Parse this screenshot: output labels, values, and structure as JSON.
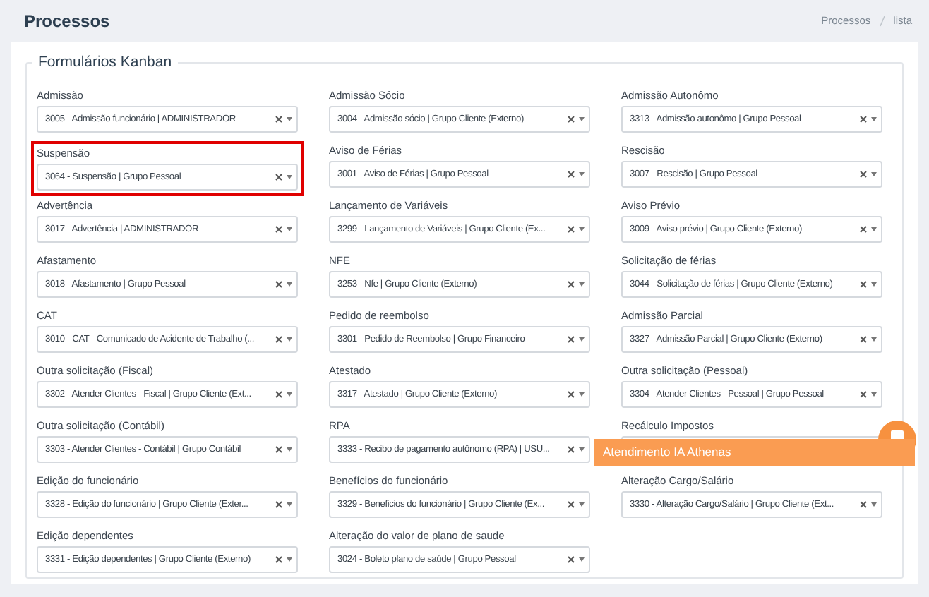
{
  "page_title": "Processos",
  "breadcrumb": [
    {
      "label": "Processos"
    },
    {
      "label": "lista"
    }
  ],
  "section": {
    "title": "Formulários Kanban",
    "fields": [
      {
        "label": "Admissão",
        "value": "3005 - Admissão funcionário | ADMINISTRADOR",
        "highlighted": false
      },
      {
        "label": "Admissão Sócio",
        "value": "3004 - Admissão sócio | Grupo Cliente (Externo)",
        "highlighted": false
      },
      {
        "label": "Admissão Autonômo",
        "value": "3313 - Admissão autonômo | Grupo Pessoal",
        "highlighted": false
      },
      {
        "label": "Suspensão",
        "value": "3064 - Suspensão | Grupo Pessoal",
        "highlighted": true
      },
      {
        "label": "Aviso de Férias",
        "value": "3001 - Aviso de Férias | Grupo Pessoal",
        "highlighted": false
      },
      {
        "label": "Rescisão",
        "value": "3007 - Rescisão | Grupo Pessoal",
        "highlighted": false
      },
      {
        "label": "Advertência",
        "value": "3017 - Advertência | ADMINISTRADOR",
        "highlighted": false
      },
      {
        "label": "Lançamento de Variáveis",
        "value": "3299 - Lançamento de Variáveis | Grupo Cliente (Ex...",
        "highlighted": false
      },
      {
        "label": "Aviso Prévio",
        "value": "3009 - Aviso prévio | Grupo Cliente (Externo)",
        "highlighted": false
      },
      {
        "label": "Afastamento",
        "value": "3018 - Afastamento | Grupo Pessoal",
        "highlighted": false
      },
      {
        "label": "NFE",
        "value": "3253 - Nfe | Grupo Cliente (Externo)",
        "highlighted": false
      },
      {
        "label": "Solicitação de férias",
        "value": "3044 - Solicitação de férias | Grupo Cliente (Externo)",
        "highlighted": false
      },
      {
        "label": "CAT",
        "value": "3010 - CAT - Comunicado de Acidente de Trabalho (...",
        "highlighted": false
      },
      {
        "label": "Pedido de reembolso",
        "value": "3301 - Pedido de Reembolso | Grupo Financeiro",
        "highlighted": false
      },
      {
        "label": "Admissão Parcial",
        "value": "3327 - Admissão Parcial | Grupo Cliente (Externo)",
        "highlighted": false
      },
      {
        "label": "Outra solicitação (Fiscal)",
        "value": "3302 - Atender Clientes - Fiscal | Grupo Cliente (Ext...",
        "highlighted": false
      },
      {
        "label": "Atestado",
        "value": "3317 - Atestado | Grupo Cliente (Externo)",
        "highlighted": false
      },
      {
        "label": "Outra solicitação (Pessoal)",
        "value": "3304 - Atender Clientes - Pessoal | Grupo Pessoal",
        "highlighted": false
      },
      {
        "label": "Outra solicitação (Contábil)",
        "value": "3303 - Atender Clientes - Contábil | Grupo Contábil",
        "highlighted": false
      },
      {
        "label": "RPA",
        "value": "3333 - Recibo de pagamento autônomo (RPA) | USU...",
        "highlighted": false
      },
      {
        "label": "Recálculo Impostos",
        "highlighted": false
      },
      {
        "label": "Edição do funcionário",
        "value": "3328 - Edição do funcionário | Grupo Cliente (Exter...",
        "highlighted": false
      },
      {
        "label": "Benefícios do funcionário",
        "value": "3329 - Beneficios do funcionário | Grupo Cliente (Ex...",
        "highlighted": false
      },
      {
        "label": "Alteração Cargo/Salário",
        "value": "3330 - Alteração Cargo/Salário | Grupo Cliente (Ext...",
        "highlighted": false
      },
      {
        "label": "Edição dependentes",
        "value": "3331 - Edição dependentes | Grupo Cliente (Externo)",
        "highlighted": false
      },
      {
        "label": "Alteração do valor de plano de saude",
        "value": "3024 - Boleto plano de saúde | Grupo Pessoal",
        "highlighted": false
      }
    ]
  },
  "chat_tooltip": {
    "text": "Atendimento IA Athenas"
  }
}
